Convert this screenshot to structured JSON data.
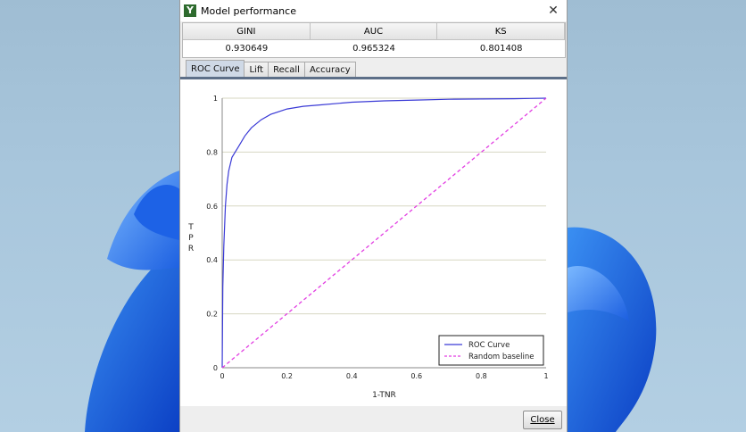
{
  "window": {
    "title": "Model performance",
    "app_icon_letter": "Y"
  },
  "metrics": {
    "headers": [
      "GINI",
      "AUC",
      "KS"
    ],
    "values": [
      "0.930649",
      "0.965324",
      "0.801408"
    ]
  },
  "tabs": [
    {
      "label": "ROC Curve",
      "active": true
    },
    {
      "label": "Lift",
      "active": false
    },
    {
      "label": "Recall",
      "active": false
    },
    {
      "label": "Accuracy",
      "active": false
    }
  ],
  "buttons": {
    "close_label": "Close"
  },
  "chart_data": {
    "type": "line",
    "xlabel": "1-TNR",
    "ylabel": "TPR",
    "xlim": [
      0,
      1
    ],
    "ylim": [
      0,
      1
    ],
    "x_ticks": [
      "0",
      "0.2",
      "0.4",
      "0.6",
      "0.8",
      "1"
    ],
    "y_ticks": [
      "0",
      "0.2",
      "0.4",
      "0.6",
      "0.8",
      "1"
    ],
    "grid": "horizontal",
    "legend_position": "bottom-right",
    "series": [
      {
        "name": "ROC Curve",
        "color": "#3a3ad6",
        "style": "solid",
        "x": [
          0,
          0.002,
          0.005,
          0.01,
          0.015,
          0.02,
          0.03,
          0.04,
          0.05,
          0.07,
          0.09,
          0.12,
          0.15,
          0.2,
          0.25,
          0.3,
          0.4,
          0.5,
          0.6,
          0.7,
          0.8,
          0.9,
          0.95,
          1.0
        ],
        "y": [
          0,
          0.3,
          0.45,
          0.6,
          0.68,
          0.73,
          0.78,
          0.8,
          0.82,
          0.86,
          0.89,
          0.92,
          0.94,
          0.96,
          0.97,
          0.975,
          0.985,
          0.99,
          0.993,
          0.996,
          0.997,
          0.998,
          0.999,
          1.0
        ]
      },
      {
        "name": "Random baseline",
        "color": "#e23ee2",
        "style": "dashed",
        "x": [
          0,
          1
        ],
        "y": [
          0,
          1
        ]
      }
    ]
  }
}
